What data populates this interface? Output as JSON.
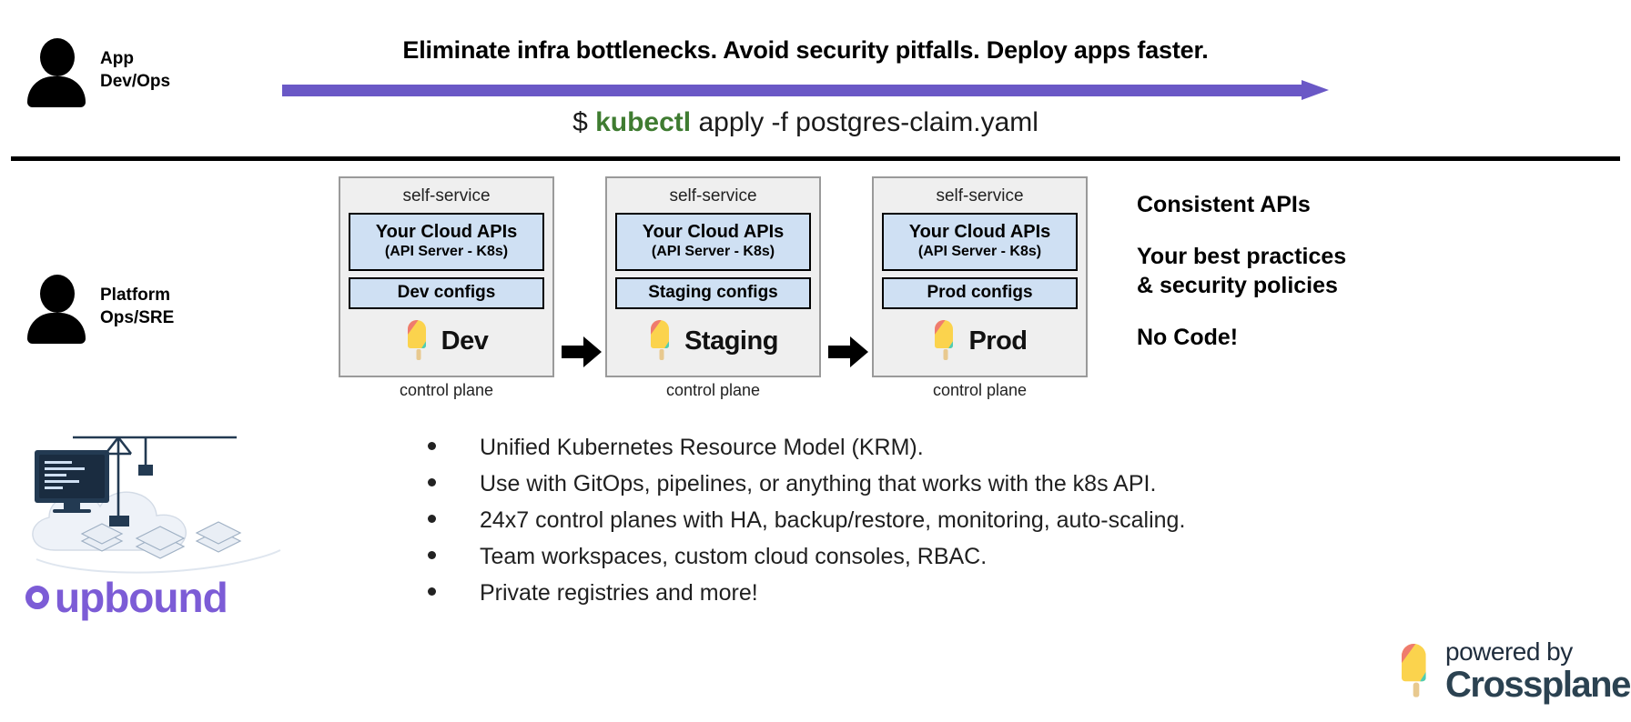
{
  "top": {
    "persona": {
      "line1": "App",
      "line2": "Dev/Ops",
      "icon": "user-avatar-icon"
    },
    "headline": "Eliminate infra bottlenecks. Avoid security pitfalls. Deploy apps faster.",
    "arrow": {
      "name": "progress-arrow",
      "color": "#6a58c6"
    },
    "command": {
      "prompt": "$",
      "binary": "kubectl",
      "args": "apply -f postgres-claim.yaml",
      "binary_color": "#3f7c31"
    }
  },
  "bottom": {
    "persona": {
      "line1": "Platform",
      "line2": "Ops/SRE",
      "icon": "user-avatar-icon"
    }
  },
  "control_planes": [
    {
      "title": "self-service",
      "api_line1": "Your Cloud APIs",
      "api_line2": "(API Server - K8s)",
      "configs": "Dev configs",
      "env": "Dev",
      "caption": "control plane"
    },
    {
      "title": "self-service",
      "api_line1": "Your Cloud APIs",
      "api_line2": "(API Server - K8s)",
      "configs": "Staging configs",
      "env": "Staging",
      "caption": "control plane"
    },
    {
      "title": "self-service",
      "api_line1": "Your Cloud APIs",
      "api_line2": "(API Server - K8s)",
      "configs": "Prod configs",
      "env": "Prod",
      "caption": "control plane"
    }
  ],
  "benefits": [
    "Consistent APIs",
    "Your best practices\n& security policies",
    "No Code!"
  ],
  "bullets": [
    "Unified Kubernetes Resource Model (KRM).",
    "Use with GitOps, pipelines, or anything that works with the k8s API.",
    "24x7 control planes with HA, backup/restore, monitoring, auto-scaling.",
    "Team workspaces, custom cloud consoles, RBAC.",
    "Private registries and more!"
  ],
  "upbound": {
    "name": "upbound",
    "color": "#7c5cd6"
  },
  "powered_by": {
    "line1": "powered by",
    "line2": "Crossplane"
  },
  "colors": {
    "accent_purple": "#6a58c6",
    "box_fill": "#efefef",
    "inner_fill": "#cfe0f3",
    "popsicle_red": "#ef7b6e",
    "popsicle_yellow": "#fbd34d",
    "popsicle_teal": "#4ecdb4"
  }
}
